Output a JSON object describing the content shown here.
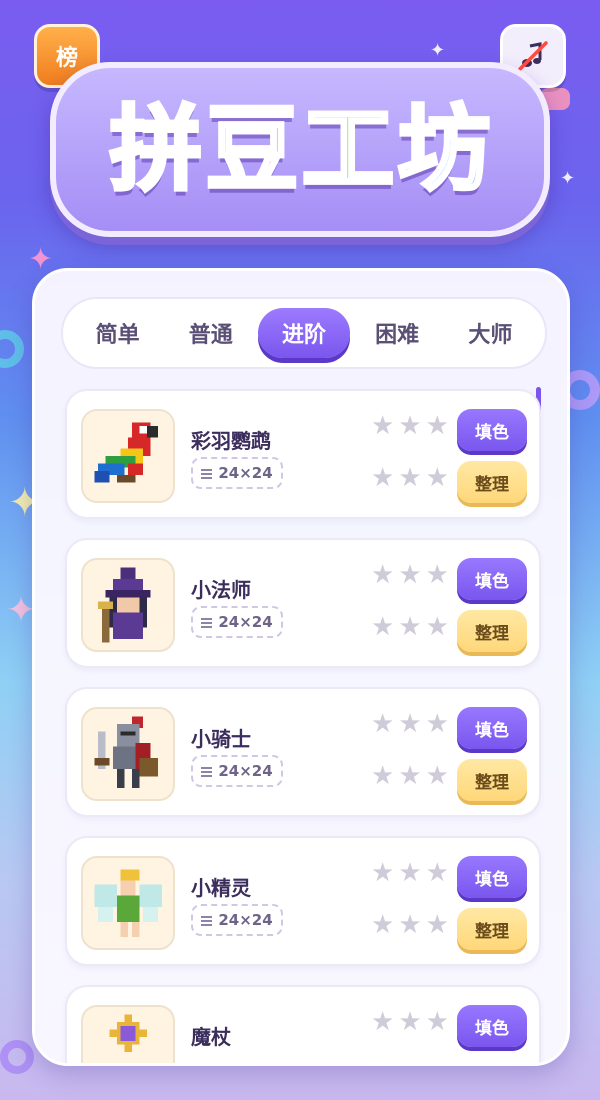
{
  "header": {
    "rank_label": "榜",
    "mute_icon": "music-muted-icon",
    "title_chars": [
      "拼",
      "豆",
      "工",
      "坊"
    ]
  },
  "tabs": [
    {
      "label": "简单",
      "active": false
    },
    {
      "label": "普通",
      "active": false
    },
    {
      "label": "进阶",
      "active": true
    },
    {
      "label": "困难",
      "active": false
    },
    {
      "label": "大师",
      "active": false
    }
  ],
  "levels": [
    {
      "name": "彩羽鹦鹉",
      "size": "24×24",
      "fill_label": "填色",
      "tidy_label": "整理",
      "fill_stars": 0,
      "tidy_stars": 0,
      "thumb": "parrot"
    },
    {
      "name": "小法师",
      "size": "24×24",
      "fill_label": "填色",
      "tidy_label": "整理",
      "fill_stars": 0,
      "tidy_stars": 0,
      "thumb": "wizard"
    },
    {
      "name": "小骑士",
      "size": "24×24",
      "fill_label": "填色",
      "tidy_label": "整理",
      "fill_stars": 0,
      "tidy_stars": 0,
      "thumb": "knight"
    },
    {
      "name": "小精灵",
      "size": "24×24",
      "fill_label": "填色",
      "tidy_label": "整理",
      "fill_stars": 0,
      "tidy_stars": 0,
      "thumb": "fairy"
    },
    {
      "name": "魔杖",
      "size": "",
      "fill_label": "填色",
      "tidy_label": "",
      "fill_stars": 0,
      "tidy_stars": 0,
      "thumb": "wand"
    }
  ],
  "colors": {
    "accent": "#7a56ee",
    "tidy": "#ffd77a",
    "star_empty": "#cfcbd8"
  }
}
